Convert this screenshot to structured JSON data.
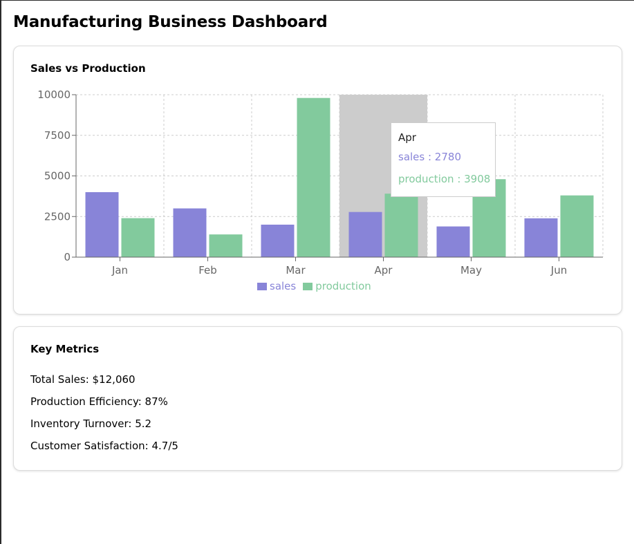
{
  "page": {
    "title": "Manufacturing Business Dashboard"
  },
  "chart_card": {
    "title": "Sales vs Production"
  },
  "chart_data": {
    "type": "bar",
    "categories": [
      "Jan",
      "Feb",
      "Mar",
      "Apr",
      "May",
      "Jun"
    ],
    "series": [
      {
        "name": "sales",
        "values": [
          4000,
          3000,
          2000,
          2780,
          1890,
          2390
        ],
        "color": "#8884d8"
      },
      {
        "name": "production",
        "values": [
          2400,
          1398,
          9800,
          3908,
          4800,
          3800
        ],
        "color": "#82ca9d"
      }
    ],
    "ylim": [
      0,
      10000
    ],
    "yticks": [
      "0",
      "2500",
      "5000",
      "7500",
      "10000"
    ],
    "grid": true,
    "legend": "bottom",
    "highlight_category": "Apr"
  },
  "tooltip": {
    "label": "Apr",
    "rows": [
      {
        "text": "sales : 2780",
        "color": "#8884d8"
      },
      {
        "text": "production : 3908",
        "color": "#82ca9d"
      }
    ]
  },
  "metrics_card": {
    "title": "Key Metrics",
    "items": [
      "Total Sales: $12,060",
      "Production Efficiency: 87%",
      "Inventory Turnover: 5.2",
      "Customer Satisfaction: 4.7/5"
    ]
  }
}
